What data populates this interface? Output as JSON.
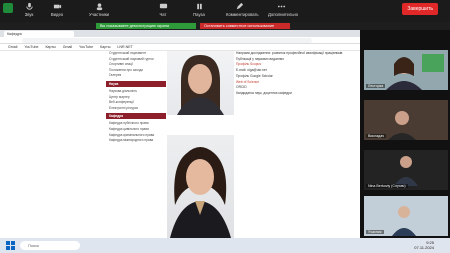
{
  "toolbar": {
    "buttons": [
      {
        "label": "Звук"
      },
      {
        "label": "Видео"
      },
      {
        "label": "Участники"
      },
      {
        "label": "Чат"
      },
      {
        "label": "Пауза"
      },
      {
        "label": "Комментировать"
      },
      {
        "label": "Дополнительно"
      }
    ],
    "end_label": "Завершить"
  },
  "share": {
    "green_label": "Вы показываете демонстрацию экрана",
    "red_label": "Остановить совместное использование"
  },
  "browser": {
    "tab_title": "Кафедра",
    "bookmarks": [
      "Gmail",
      "YouTube",
      "Карты",
      "Gmail",
      "YouTube",
      "Карты",
      "LNR.NET"
    ]
  },
  "sidebar": {
    "items": [
      "Студентський парламент",
      "Студентський науковий гурток",
      "Спортивні секції",
      "Положення про заходи",
      "Галерея"
    ],
    "header_1": "Наука",
    "items_2": [
      "Наукова діяльність",
      "Центр мартер",
      "Веб-конференції",
      "Електронні ресурси"
    ],
    "header_2": "Кафедри",
    "items_3": [
      "Кафедра публічного права",
      "Кафедра цивільного права",
      "Кафедра кримінального права",
      "Кафедра міжнародного права"
    ]
  },
  "text": {
    "paragraphs": [
      "Напрями дослідження: розвиток професійної кваліфікації працівників.",
      "Публікації у наукових виданнях",
      "E-mail: olga@ukr.net",
      "Профіль Google Scholar",
      "ORCID",
      "Кандидатка наук, доцентка кафедри"
    ],
    "link_1": "Профіль Scopus",
    "link_2": "Web of Science"
  },
  "gallery": {
    "tiles": [
      {
        "name": "Лекторка"
      },
      {
        "name": "Викладач"
      },
      {
        "name": "Nina Berkoviy (Слухач)"
      },
      {
        "name": "Учасник"
      }
    ]
  },
  "taskbar": {
    "search_placeholder": "Поиск",
    "time": "9:25",
    "date": "07.11.2024"
  }
}
